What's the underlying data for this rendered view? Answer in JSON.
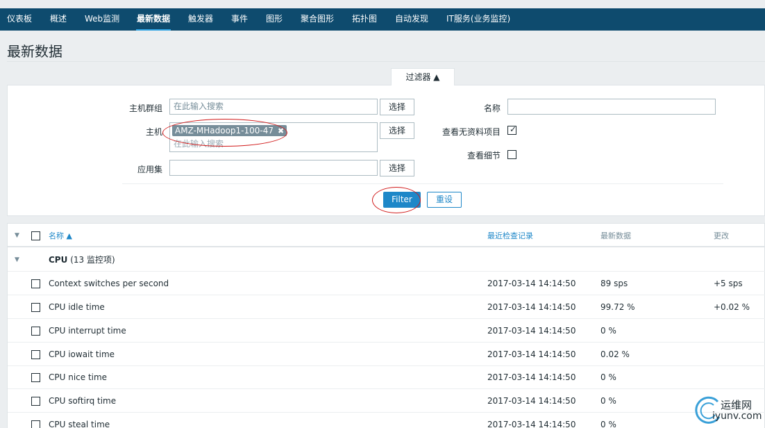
{
  "nav": {
    "items": [
      "仪表板",
      "概述",
      "Web监测",
      "最新数据",
      "触发器",
      "事件",
      "图形",
      "聚合图形",
      "拓扑图",
      "自动发现",
      "IT服务(业务监控)"
    ],
    "active": "最新数据"
  },
  "page": {
    "title": "最新数据"
  },
  "filter": {
    "tab_label": "过滤器 ▲",
    "host_group": {
      "label": "主机群组",
      "placeholder": "在此输入搜索",
      "select_label": "选择"
    },
    "host": {
      "label": "主机",
      "tag": "AMZ-MHadoop1-100-47",
      "placeholder": "在此输入搜索",
      "select_label": "选择"
    },
    "application": {
      "label": "应用集",
      "value": "",
      "select_label": "选择"
    },
    "name": {
      "label": "名称",
      "value": ""
    },
    "show_no_data": {
      "label": "查看无资料项目",
      "checked": true
    },
    "show_details": {
      "label": "查看细节",
      "checked": false
    },
    "filter_button": "Filter",
    "reset_button": "重设"
  },
  "table": {
    "headers": {
      "name": "名称 ▲",
      "last_check": "最近检查记录",
      "last_value": "最新数据",
      "change": "更改"
    },
    "group": {
      "name": "CPU",
      "count": "(13 监控项)"
    },
    "rows": [
      {
        "name": "Context switches per second",
        "last_check": "2017-03-14 14:14:50",
        "last_value": "89 sps",
        "change": "+5 sps"
      },
      {
        "name": "CPU idle time",
        "last_check": "2017-03-14 14:14:50",
        "last_value": "99.72 %",
        "change": "+0.02 %"
      },
      {
        "name": "CPU interrupt time",
        "last_check": "2017-03-14 14:14:50",
        "last_value": "0 %",
        "change": ""
      },
      {
        "name": "CPU iowait time",
        "last_check": "2017-03-14 14:14:50",
        "last_value": "0.02 %",
        "change": ""
      },
      {
        "name": "CPU nice time",
        "last_check": "2017-03-14 14:14:50",
        "last_value": "0 %",
        "change": ""
      },
      {
        "name": "CPU softirq time",
        "last_check": "2017-03-14 14:14:50",
        "last_value": "0 %",
        "change": ""
      },
      {
        "name": "CPU steal time",
        "last_check": "2017-03-14 14:14:50",
        "last_value": "0 %",
        "change": ""
      }
    ]
  },
  "watermark": {
    "line1": "运维网",
    "line2": "iyunv.com"
  },
  "colors": {
    "nav_bg": "#0e4b6e",
    "accent": "#1e87c8",
    "annotation": "#d11a1a"
  }
}
